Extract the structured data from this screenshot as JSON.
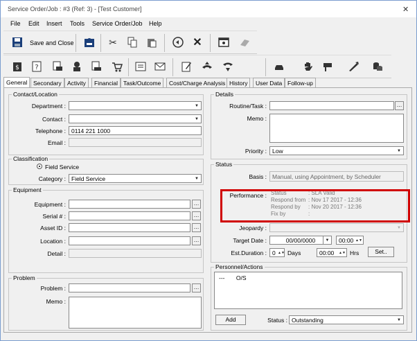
{
  "window": {
    "title": "Service Order/Job : #3 (Ref: 3) - [Test Customer]",
    "close": "✕"
  },
  "menu": [
    "File",
    "Edit",
    "Insert",
    "Tools",
    "Service Order/Job",
    "Help"
  ],
  "toolbar": {
    "save_close_label": "Save and Close"
  },
  "tabs": [
    "General",
    "Secondary",
    "Activity",
    "Financial",
    "Task/Outcome",
    "Cost/Charge Analysis",
    "History",
    "User Data",
    "Follow-up"
  ],
  "contact": {
    "title": "Contact/Location",
    "department_label": "Department :",
    "department": "",
    "contact_label": "Contact :",
    "contact": "",
    "telephone_label": "Telephone :",
    "telephone": "0114 221 1000",
    "email_label": "Email :",
    "email": ""
  },
  "classification": {
    "title": "Classification",
    "radio_label": "Field Service",
    "category_label": "Category :",
    "category": "Field Service"
  },
  "equipment": {
    "title": "Equipment",
    "equipment_label": "Equipment :",
    "serial_label": "Serial # :",
    "asset_label": "Asset ID :",
    "location_label": "Location :",
    "detail_label": "Detail :"
  },
  "problem": {
    "title": "Problem",
    "problem_label": "Problem :",
    "memo_label": "Memo :"
  },
  "details": {
    "title": "Details",
    "routine_label": "Routine/Task :",
    "memo_label": "Memo :",
    "priority_label": "Priority :",
    "priority": "Low"
  },
  "status": {
    "title": "Status",
    "basis_label": "Basis :",
    "basis": "Manual, using Appointment, by Scheduler",
    "performance_label": "Performance :",
    "performance_rows": [
      {
        "k": "Status",
        "v": ": SLA Valid"
      },
      {
        "k": "Respond from",
        "v": ": Nov 17 2017 - 12:36"
      },
      {
        "k": "Respond by",
        "v": ": Nov 20 2017 - 12:36"
      },
      {
        "k": "Fix by",
        "v": ":"
      }
    ],
    "jeopardy_label": "Jeopardy :",
    "target_label": "Target Date :",
    "target_date": "00/00/0000",
    "target_time": "00:00",
    "duration_label": "Est.Duration :",
    "duration_days": "0",
    "days_label": "Days",
    "duration_hrs": "00:00",
    "hrs_label": "Hrs",
    "set_label": "Set.."
  },
  "personnel": {
    "title": "Personnel/Actions",
    "row_dash": "---",
    "row_status": "O/S",
    "add_label": "Add",
    "status_label": "Status :",
    "status_value": "Outstanding"
  },
  "colors": {
    "highlight": "#d00000"
  }
}
